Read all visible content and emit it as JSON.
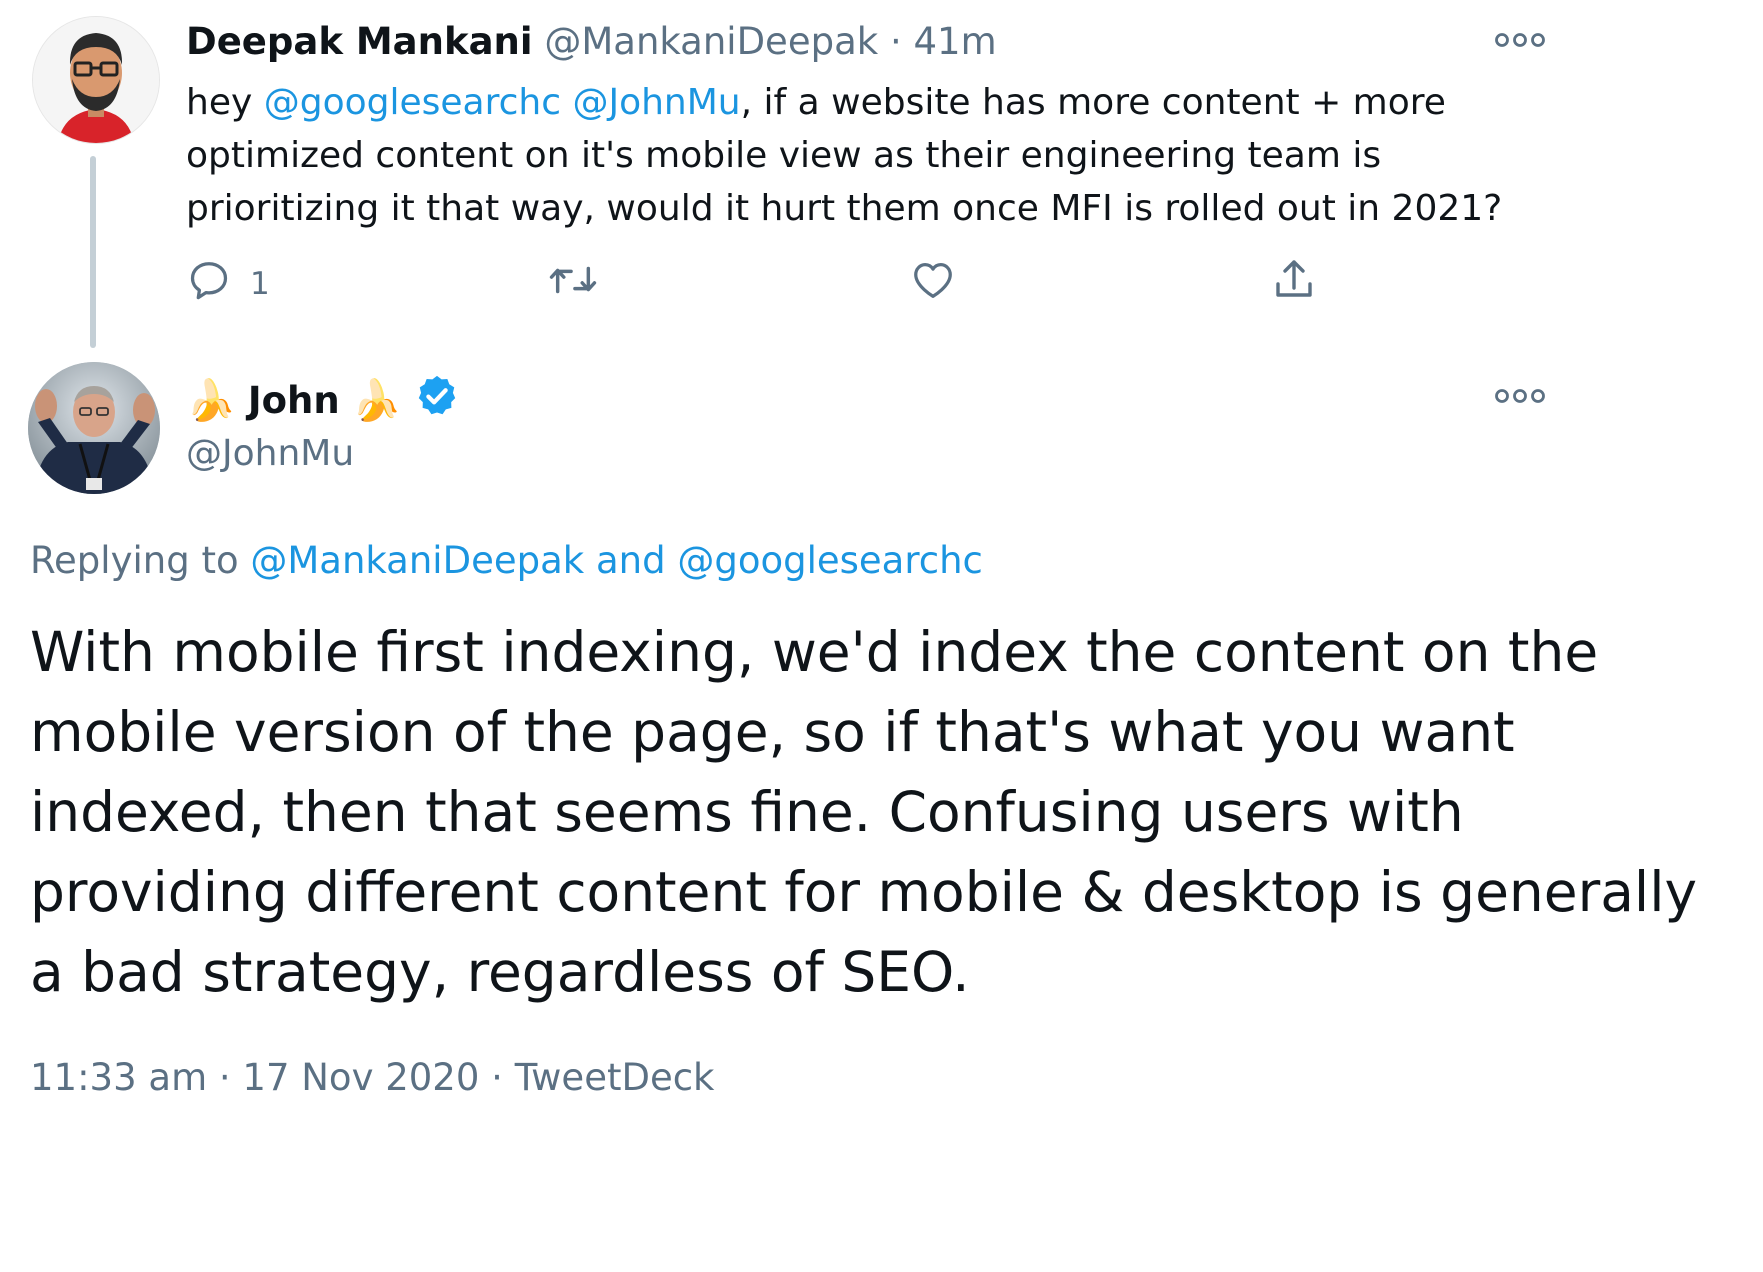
{
  "tweet": {
    "author_name": "Deepak Mankani",
    "author_handle": "@MankaniDeepak",
    "separator": "·",
    "time_ago": "41m",
    "text_prefix": "hey ",
    "mention_1": "@googlesearchc",
    "mention_sep": " ",
    "mention_2": "@JohnMu",
    "text_body": ", if a website has more content + more optimized content on it's mobile view as their engineering team is prioritizing it that way, would it hurt them once MFI is rolled out in 2021?",
    "reply_count": "1",
    "icons": [
      "more-icon",
      "reply-icon",
      "retweet-icon",
      "like-icon",
      "share-icon"
    ]
  },
  "reply": {
    "author_name": "John",
    "name_emoji": "🍌",
    "verified_icon": "verified-badge-icon",
    "author_handle": "@JohnMu",
    "replying_label": "Replying to ",
    "replying_user_1": "@MankaniDeepak",
    "replying_and": " and ",
    "replying_user_2": "@googlesearchc",
    "text": "With mobile first indexing, we'd index the content on the mobile version of the page, so if that's what you want indexed, then that seems fine. Confusing users with providing different content for mobile & desktop is generally a bad strategy, regardless of SEO.",
    "time": "11:33 am",
    "date": "17 Nov 2020",
    "source": "TweetDeck",
    "separator": "·"
  },
  "colors": {
    "link": "#1b95e0",
    "secondary_text": "#5b7083",
    "primary_text": "#0f1419",
    "verified": "#1da1f2",
    "thread_line": "#c4cfd6"
  }
}
